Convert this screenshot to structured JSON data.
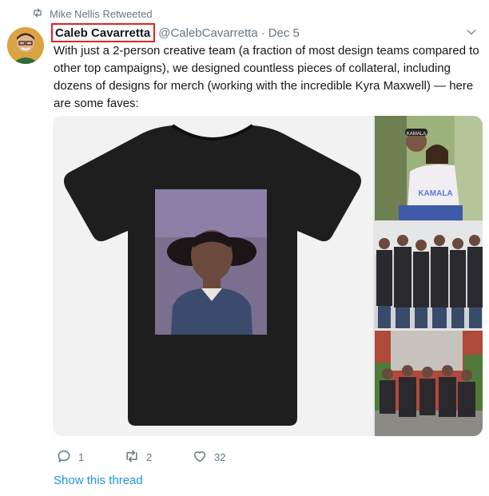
{
  "retweet": {
    "text": "Mike Nellis Retweeted",
    "icon": "retweet-icon"
  },
  "author": {
    "name": "Caleb Cavarretta",
    "handle": "@CalebCavarretta",
    "separator": "·",
    "date": "Dec 5"
  },
  "tweet": {
    "text": "With just a 2-person creative team (a fraction of most design teams compared to other top campaigns), we designed countless pieces of collateral, including dozens of designs for merch (working with the incredible Kyra Maxwell) — here are some faves:"
  },
  "media": {
    "side_image_text": [
      "KAMALA",
      "KAMALA"
    ]
  },
  "actions": {
    "reply_count": "1",
    "retweet_count": "2",
    "like_count": "32"
  },
  "thread": {
    "label": "Show this thread"
  },
  "colors": {
    "highlight_box": "#e02424",
    "link": "#1b95e0",
    "muted": "#657786"
  }
}
